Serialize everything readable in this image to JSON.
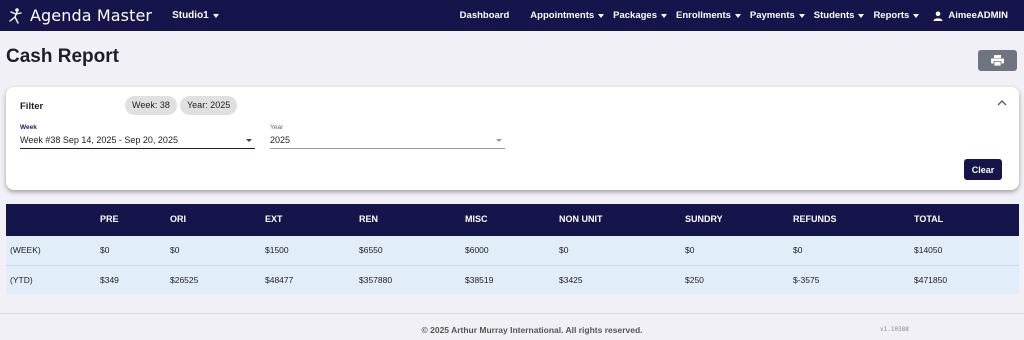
{
  "app": {
    "name": "Agenda Master",
    "studio": "Studio1"
  },
  "nav": {
    "dashboard": "Dashboard",
    "appointments": "Appointments",
    "packages": "Packages",
    "enrollments": "Enrollments",
    "payments": "Payments",
    "students": "Students",
    "reports": "Reports",
    "user": "AimeeADMIN"
  },
  "page": {
    "title": "Cash Report",
    "print_icon": "printer-icon"
  },
  "filter": {
    "label": "Filter",
    "chips": [
      "Week: 38",
      "Year: 2025"
    ],
    "week_label": "Week",
    "week_value": "Week #38 Sep 14, 2025 - Sep 20, 2025",
    "year_label": "Year",
    "year_value": "2025",
    "clear_label": "Clear"
  },
  "table": {
    "columns": [
      "",
      "PRE",
      "ORI",
      "EXT",
      "REN",
      "MISC",
      "NON UNIT",
      "SUNDRY",
      "REFUNDS",
      "TOTAL"
    ],
    "rows": [
      [
        "(WEEK)",
        "$0",
        "$0",
        "$1500",
        "$6550",
        "$6000",
        "$0",
        "$0",
        "$0",
        "$14050"
      ],
      [
        "(YTD)",
        "$349",
        "$26525",
        "$48477",
        "$357880",
        "$38519",
        "$3425",
        "$250",
        "$-3575",
        "$471850"
      ]
    ]
  },
  "footer": {
    "copyright": "© 2025 Arthur Murray International. All rights reserved.",
    "version": "v1.10388"
  },
  "colors": {
    "navbar": "#15144b",
    "accent": "#1f1d62",
    "row_bg": "#e1edf9",
    "print_button": "#6f7580"
  }
}
